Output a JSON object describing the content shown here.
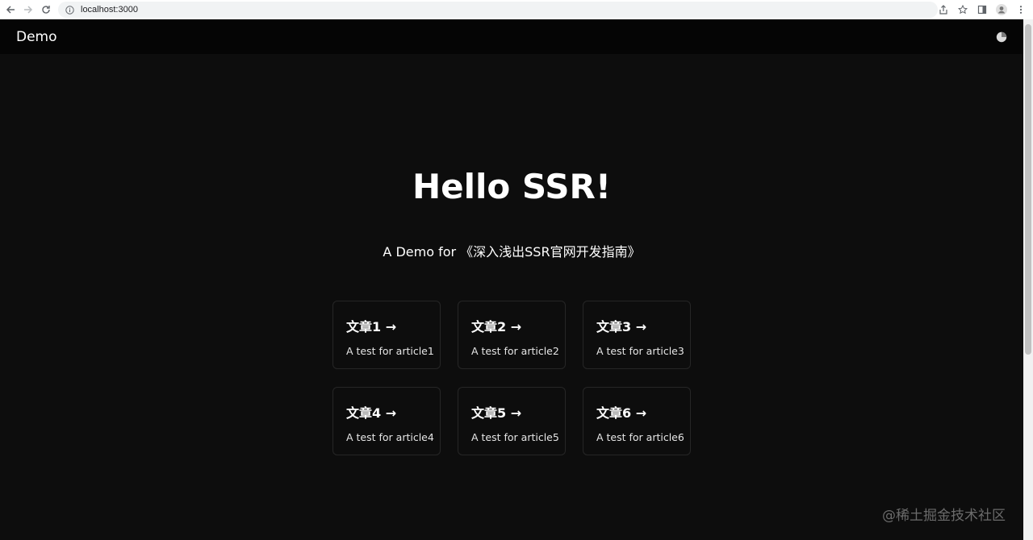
{
  "browser": {
    "url": "localhost:3000",
    "icons": [
      "back-icon",
      "forward-icon",
      "reload-icon",
      "info-icon",
      "share-icon",
      "star-icon",
      "side-panel-icon",
      "profile-icon",
      "menu-icon"
    ]
  },
  "header": {
    "brand": "Demo",
    "theme_icon": "half-moon-icon"
  },
  "hero": {
    "title": "Hello SSR!",
    "subtitle": "A Demo for 《深入浅出SSR官网开发指南》"
  },
  "articles": [
    {
      "title": "文章1 →",
      "desc": "A test for article1"
    },
    {
      "title": "文章2 →",
      "desc": "A test for article2"
    },
    {
      "title": "文章3 →",
      "desc": "A test for article3"
    },
    {
      "title": "文章4 →",
      "desc": "A test for article4"
    },
    {
      "title": "文章5 →",
      "desc": "A test for article5"
    },
    {
      "title": "文章6 →",
      "desc": "A test for article6"
    }
  ],
  "watermark": "@稀土掘金技术社区",
  "colors": {
    "page_bg": "#0d0d0d",
    "header_bg": "#050505",
    "card_border": "#262626",
    "text": "#ffffff"
  }
}
